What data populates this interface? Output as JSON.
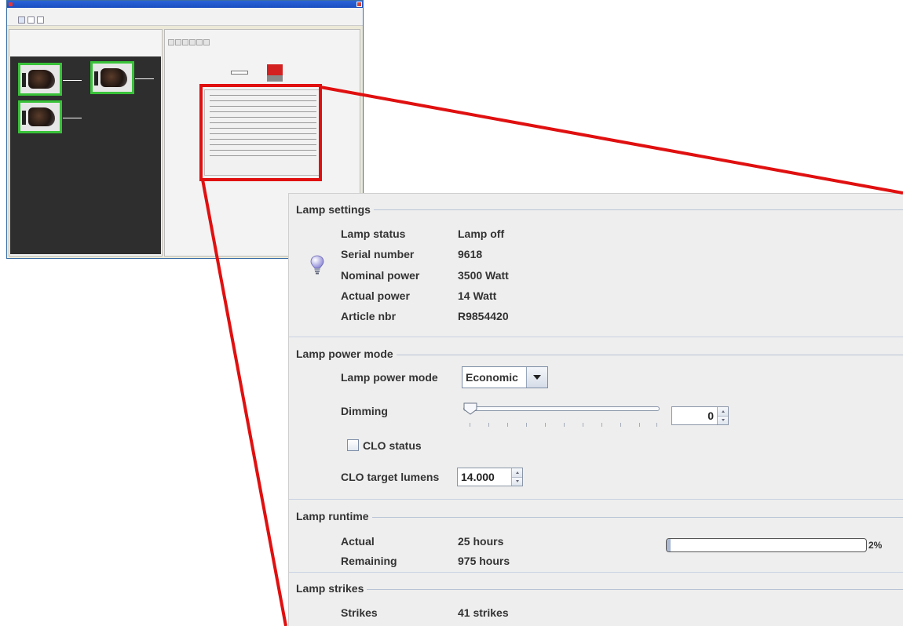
{
  "lamp_settings": {
    "title": "Lamp settings",
    "rows": [
      {
        "label": "Lamp status",
        "value": "Lamp off"
      },
      {
        "label": "Serial number",
        "value": "9618"
      },
      {
        "label": "Nominal power",
        "value": "3500 Watt"
      },
      {
        "label": "Actual power",
        "value": "14 Watt"
      },
      {
        "label": "Article nbr",
        "value": "R9854420"
      }
    ],
    "icon": "lightbulb-icon"
  },
  "lamp_power_mode": {
    "title": "Lamp power mode",
    "mode_label": "Lamp power mode",
    "mode_value": "Economic",
    "dimming_label": "Dimming",
    "dimming_value": "0",
    "clo_status_label": "CLO status",
    "clo_status_checked": false,
    "clo_target_label": "CLO target lumens",
    "clo_target_value": "14.000"
  },
  "lamp_runtime": {
    "title": "Lamp runtime",
    "actual_label": "Actual",
    "actual_value": "25 hours",
    "remaining_label": "Remaining",
    "remaining_value": "975 hours",
    "progress_percent": 2,
    "progress_text": "2%"
  },
  "lamp_strikes": {
    "title": "Lamp strikes",
    "strikes_label": "Strikes",
    "strikes_value": "41 strikes"
  },
  "colors": {
    "highlight": "#e01010",
    "projector_border": "#39c239",
    "canvas_bg": "#2e2e2e"
  }
}
